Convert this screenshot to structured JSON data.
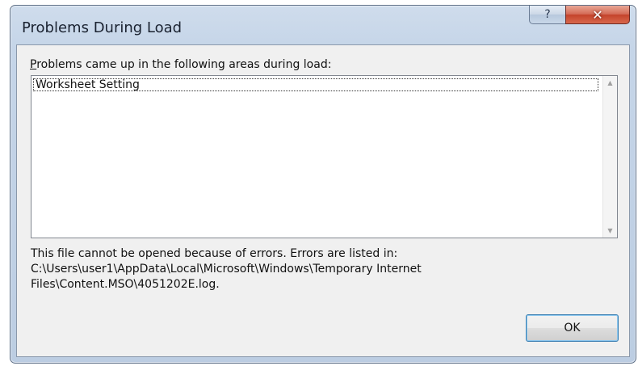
{
  "window": {
    "title": "Problems During Load",
    "help_glyph": "?",
    "close_glyph": "✕"
  },
  "prompt": {
    "first_letter": "P",
    "rest": "roblems came up in the following areas during load:"
  },
  "problems_list": {
    "items": [
      "Worksheet Setting"
    ],
    "scroll_up_icon": "▲",
    "scroll_down_icon": "▼"
  },
  "message": {
    "line1": "This file cannot be opened because of errors.  Errors are listed in:",
    "line2": "C:\\Users\\user1\\AppData\\Local\\Microsoft\\Windows\\Temporary Internet",
    "line3": "Files\\Content.MSO\\4051202E.log."
  },
  "buttons": {
    "ok_label": "OK"
  },
  "colors": {
    "close_button": "#c4432b",
    "ok_border": "#3c7fb1"
  }
}
